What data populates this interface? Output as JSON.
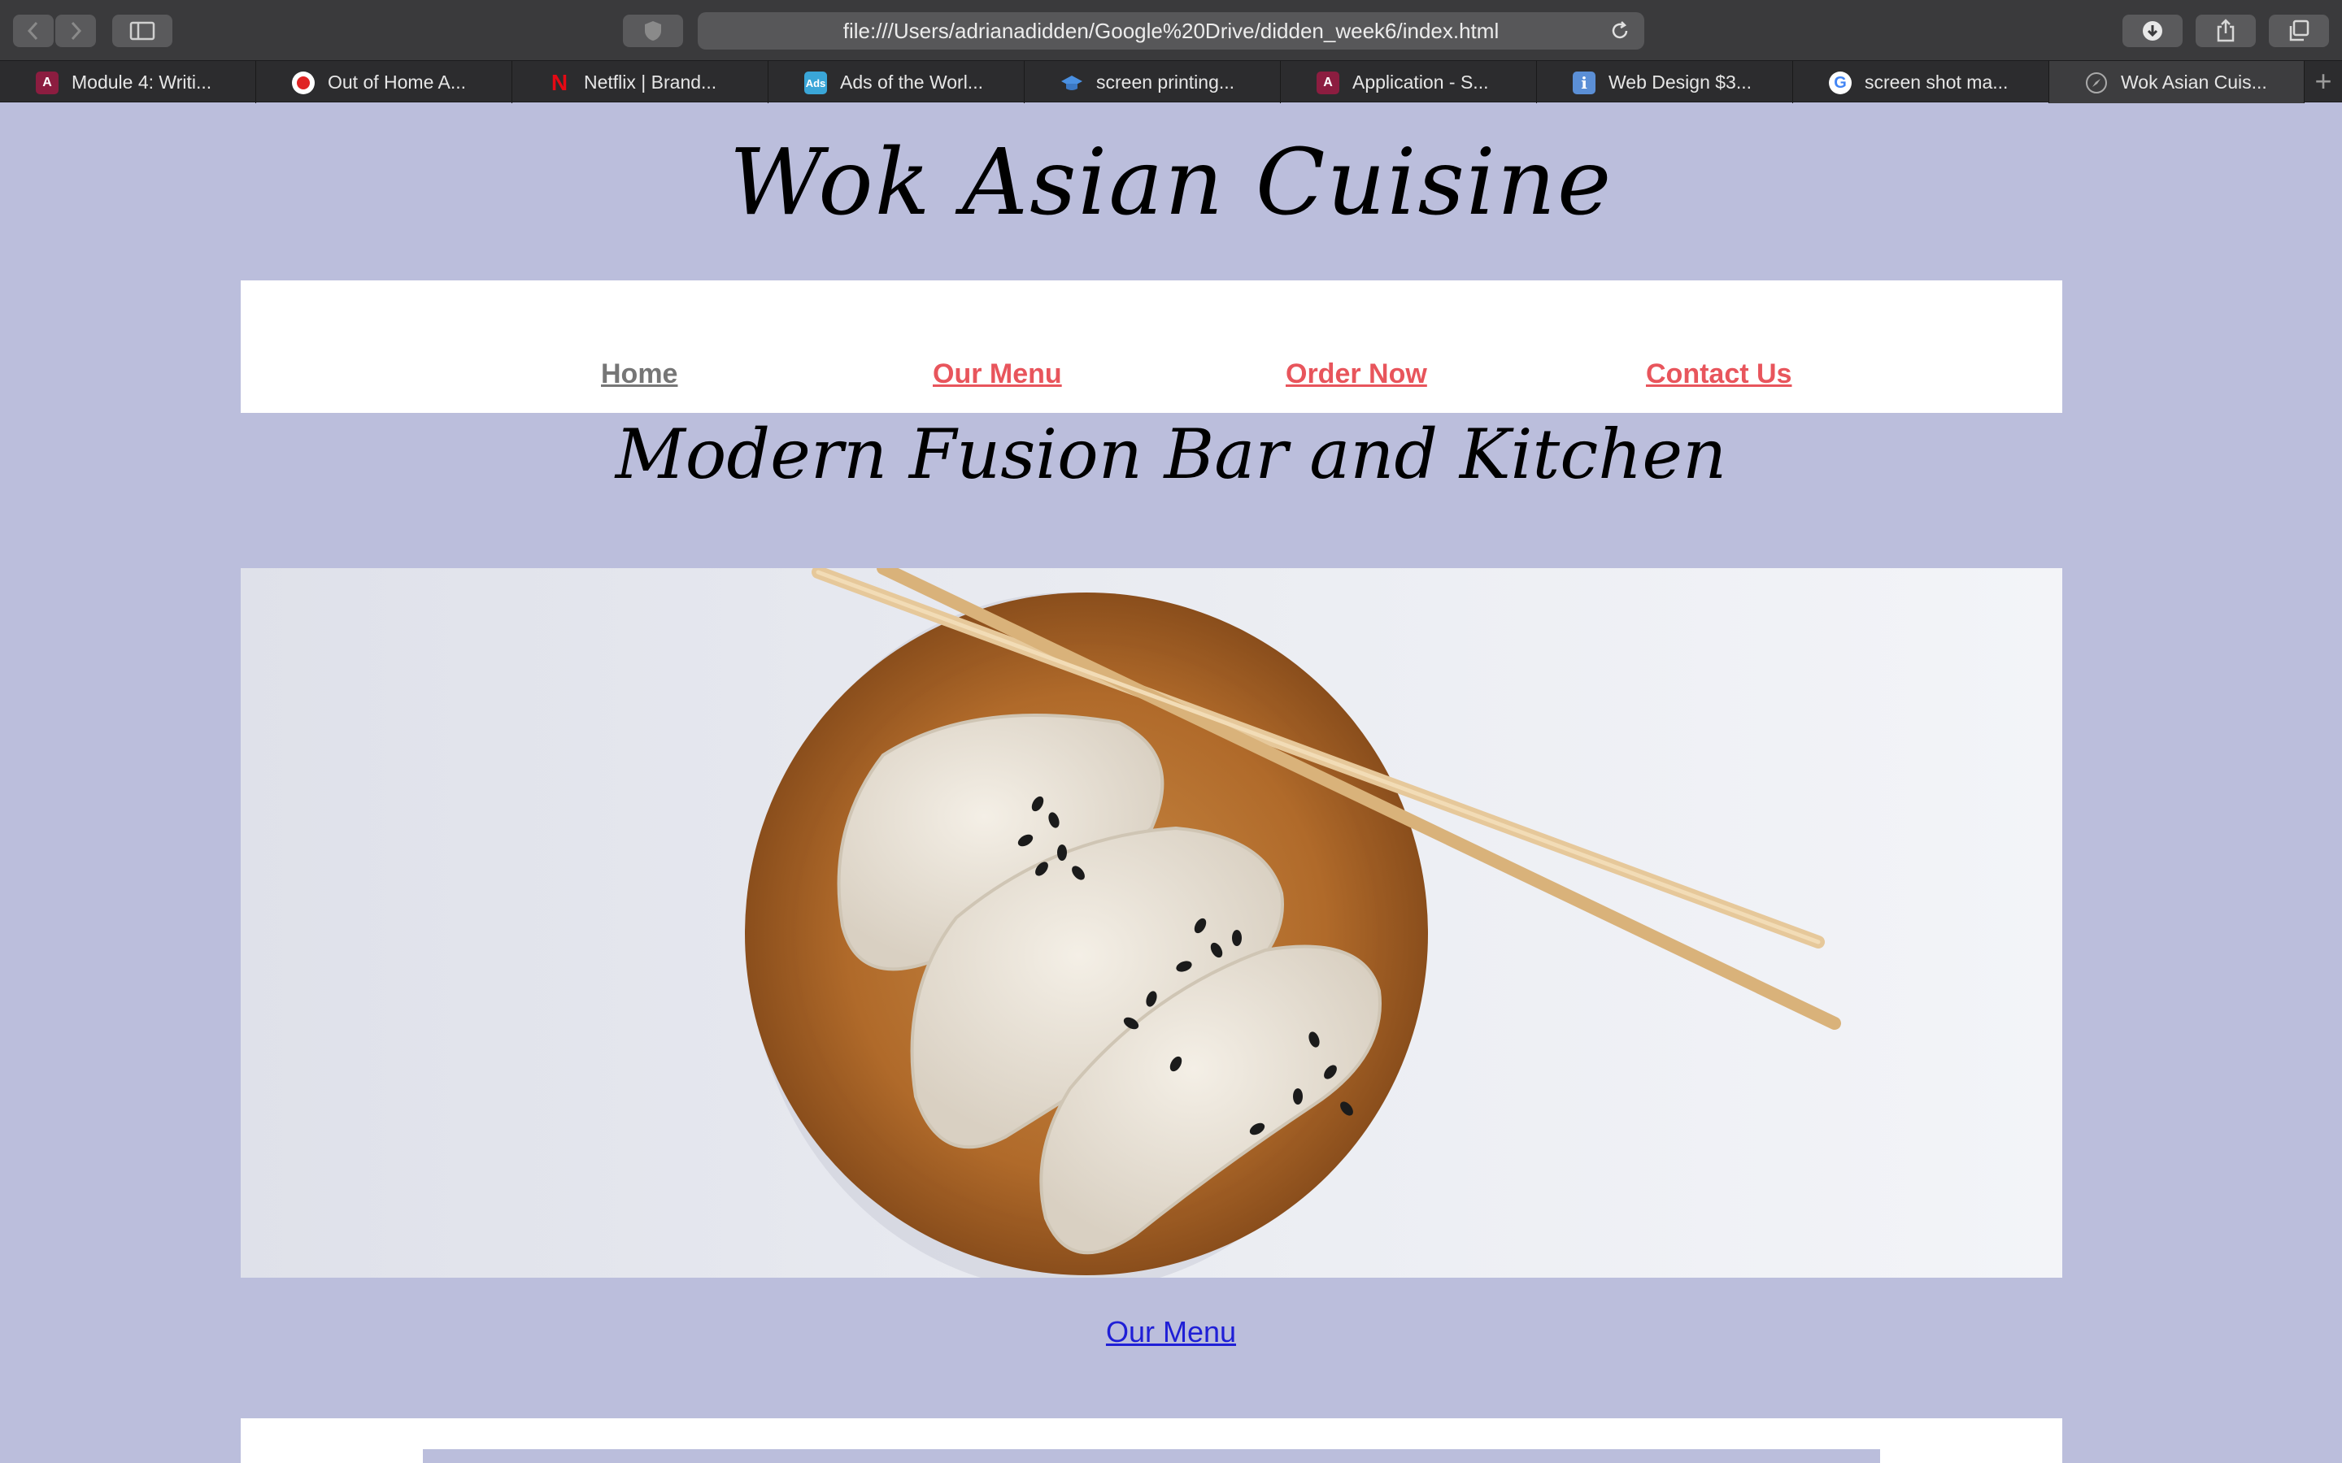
{
  "browser": {
    "url": "file:///Users/adrianadidden/Google%20Drive/didden_week6/index.html",
    "tabs": [
      {
        "label": "Module 4: Writi...",
        "icon": "asu-icon",
        "color": "#8c1d40"
      },
      {
        "label": "Out of Home A...",
        "icon": "ooh-icon",
        "color": "#e02424"
      },
      {
        "label": "Netflix | Brand...",
        "icon": "netflix-icon",
        "color": "#e50914"
      },
      {
        "label": "Ads of the Worl...",
        "icon": "ads-icon",
        "color": "#3aa6d8"
      },
      {
        "label": "screen printing...",
        "icon": "graduation-cap-icon",
        "color": "#4a90e2"
      },
      {
        "label": "Application - S...",
        "icon": "asu-icon",
        "color": "#8c1d40"
      },
      {
        "label": "Web Design $3...",
        "icon": "info-icon",
        "color": "#5b8fd6"
      },
      {
        "label": "screen shot ma...",
        "icon": "google-icon",
        "color": "#ffffff"
      },
      {
        "label": "Wok Asian Cuis...",
        "icon": "compass-icon",
        "color": "#888888"
      }
    ],
    "active_tab": 8
  },
  "page": {
    "title": "Wok Asian Cuisine",
    "nav": {
      "home": "Home",
      "menu": "Our Menu",
      "order": "Order Now",
      "contact": "Contact Us"
    },
    "subtitle": "Modern Fusion Bar and Kitchen",
    "hero_alt": "dumplings-on-wooden-plate",
    "menu_link": "Our Menu"
  },
  "colors": {
    "page_bg": "#bbbedc",
    "nav_red": "#e8555c",
    "nav_gray": "#767676",
    "link_blue": "#1f1fd6"
  }
}
